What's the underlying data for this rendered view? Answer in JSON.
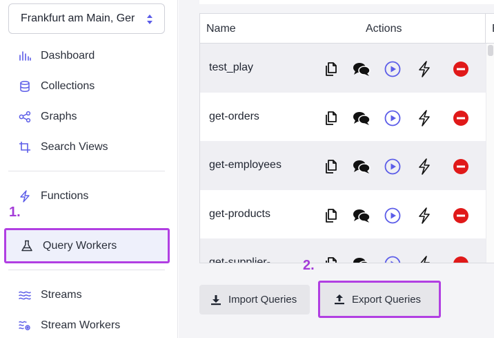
{
  "sidebar": {
    "region": "Frankfurt am Main, Ger",
    "nav": {
      "dashboard": "Dashboard",
      "collections": "Collections",
      "graphs": "Graphs",
      "search_views": "Search Views",
      "functions": "Functions",
      "query_workers": "Query Workers",
      "streams": "Streams",
      "stream_workers": "Stream Workers"
    },
    "active_item": "Query Workers"
  },
  "annotations": {
    "step1": "1.",
    "step2": "2."
  },
  "accent_color": "#5b5ce8",
  "highlight_color": "#b13fe2",
  "danger_color": "#e01919",
  "table": {
    "columns": {
      "name": "Name",
      "actions": "Actions",
      "more": "E"
    },
    "rows": [
      {
        "name": "test_play"
      },
      {
        "name": "get-orders"
      },
      {
        "name": "get-employees"
      },
      {
        "name": "get-products"
      },
      {
        "name": "get-supplier-"
      }
    ],
    "row_action_icons": [
      "copy-icon",
      "comments-icon",
      "play-icon",
      "bolt-icon",
      "remove-icon"
    ]
  },
  "buttons": {
    "import": "Import Queries",
    "export": "Export Queries"
  }
}
